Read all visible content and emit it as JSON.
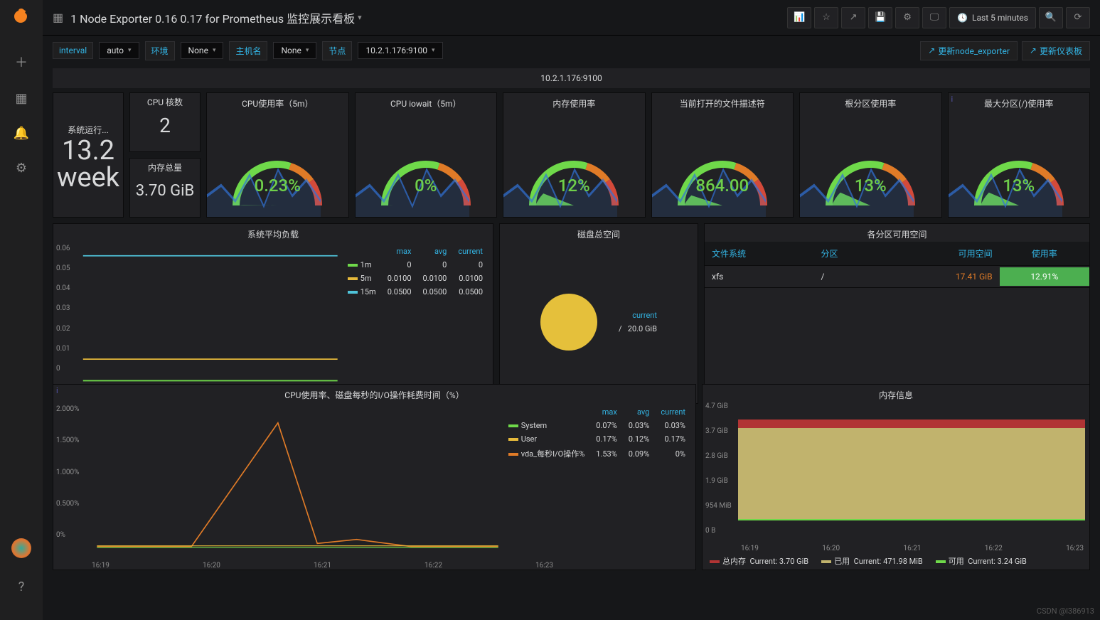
{
  "dashboard_title": "1 Node Exporter 0.16 0.17 for Prometheus 监控展示看板",
  "time_range": "Last 5 minutes",
  "variables": {
    "interval_label": "interval",
    "interval_value": "auto",
    "env_label": "环境",
    "env_value": "None",
    "host_label": "主机名",
    "host_value": "None",
    "node_label": "节点",
    "node_value": "10.2.1.176:9100"
  },
  "links": {
    "update_exporter": "更新node_exporter",
    "update_dashboard": "更新仪表板"
  },
  "row_header": "10.2.1.176:9100",
  "stats": {
    "uptime_title": "系统运行...",
    "uptime_value": "13.2 week",
    "cores_title": "CPU 核数",
    "cores_value": "2",
    "mem_title": "内存总量",
    "mem_value": "3.70 GiB"
  },
  "gauges": [
    {
      "title": "CPU使用率（5m）",
      "value": "0.23%",
      "pct": 0.23
    },
    {
      "title": "CPU iowait（5m）",
      "value": "0%",
      "pct": 0
    },
    {
      "title": "内存使用率",
      "value": "12%",
      "pct": 12
    },
    {
      "title": "当前打开的文件描述符",
      "value": "864.00",
      "pct": 10
    },
    {
      "title": "根分区使用率",
      "value": "13%",
      "pct": 13
    },
    {
      "title": "最大分区(/)使用率",
      "value": "13%",
      "pct": 13
    }
  ],
  "load_panel": {
    "title": "系统平均负载",
    "yticks": [
      "0.06",
      "0.05",
      "0.04",
      "0.03",
      "0.02",
      "0.01",
      "0"
    ],
    "xticks": [
      "16:19",
      "16:20",
      "16:21",
      "16:22",
      "16:23"
    ],
    "cols": [
      "max",
      "avg",
      "current"
    ],
    "series": [
      {
        "name": "1m",
        "color": "#6fd94a",
        "vals": [
          "0",
          "0",
          "0"
        ]
      },
      {
        "name": "5m",
        "color": "#e5b93b",
        "vals": [
          "0.0100",
          "0.0100",
          "0.0100"
        ]
      },
      {
        "name": "15m",
        "color": "#4fc3d9",
        "vals": [
          "0.0500",
          "0.0500",
          "0.0500"
        ]
      }
    ]
  },
  "disk_panel": {
    "title": "磁盘总空间",
    "legend_header": "current",
    "item": "/",
    "value": "20.0 GiB"
  },
  "partition_panel": {
    "title": "各分区可用空间",
    "headers": [
      "文件系统",
      "分区",
      "可用空间",
      "使用率"
    ],
    "row": {
      "fs": "xfs",
      "part": "/",
      "avail": "17.41 GiB",
      "use": "12.91%"
    }
  },
  "cpuio_panel": {
    "title": "CPU使用率、磁盘每秒的I/O操作耗费时间（%）",
    "yticks": [
      "2.000%",
      "1.500%",
      "1.000%",
      "0.500%",
      "0%"
    ],
    "xticks": [
      "16:19",
      "16:20",
      "16:21",
      "16:22",
      "16:23"
    ],
    "cols": [
      "max",
      "avg",
      "current"
    ],
    "series": [
      {
        "name": "System",
        "color": "#6fd94a",
        "vals": [
          "0.07%",
          "0.03%",
          "0.03%"
        ]
      },
      {
        "name": "User",
        "color": "#e5b93b",
        "vals": [
          "0.17%",
          "0.12%",
          "0.17%"
        ]
      },
      {
        "name": "vda_每秒I/O操作%",
        "color": "#e07b27",
        "vals": [
          "1.53%",
          "0.09%",
          "0%"
        ]
      }
    ]
  },
  "mem_panel": {
    "title": "内存信息",
    "yticks": [
      "4.7 GiB",
      "3.7 GiB",
      "2.8 GiB",
      "1.9 GiB",
      "954 MiB",
      "0 B"
    ],
    "xticks": [
      "16:19",
      "16:20",
      "16:21",
      "16:22",
      "16:23"
    ],
    "legend": [
      {
        "name": "总内存",
        "color": "#b13434",
        "current": "Current: 3.70 GiB"
      },
      {
        "name": "已用",
        "color": "#c1b36d",
        "current": "Current: 471.98 MiB"
      },
      {
        "name": "可用",
        "color": "#6fd94a",
        "current": "Current: 3.24 GiB"
      }
    ]
  },
  "watermark": "CSDN @l386913",
  "chart_data": {
    "type": "dashboard",
    "gauges": [
      {
        "label": "CPU使用率（5m）",
        "value": 0.23
      },
      {
        "label": "CPU iowait（5m）",
        "value": 0
      },
      {
        "label": "内存使用率",
        "value": 12
      },
      {
        "label": "打开文件描述符",
        "value": 864
      },
      {
        "label": "根分区使用率",
        "value": 13
      },
      {
        "label": "最大分区使用率",
        "value": 13
      }
    ],
    "load": {
      "x": [
        "16:19",
        "16:20",
        "16:21",
        "16:22",
        "16:23"
      ],
      "series": [
        {
          "name": "1m",
          "flat": 0
        },
        {
          "name": "5m",
          "flat": 0.01
        },
        {
          "name": "15m",
          "flat": 0.05
        }
      ],
      "ylim": [
        0,
        0.06
      ]
    },
    "disk_total": {
      "/": 20.0,
      "unit": "GiB"
    },
    "partitions": [
      {
        "fs": "xfs",
        "mount": "/",
        "avail_gib": 17.41,
        "use_pct": 12.91
      }
    ],
    "cpu_io": {
      "x": [
        "16:19",
        "16:20",
        "16:21",
        "16:22",
        "16:23"
      ],
      "ylim": [
        0,
        2.0
      ],
      "series": [
        {
          "name": "System",
          "values": [
            0.03,
            0.03,
            0.07,
            0.03,
            0.03
          ]
        },
        {
          "name": "User",
          "values": [
            0.12,
            0.12,
            0.17,
            0.14,
            0.17
          ]
        },
        {
          "name": "vda_io",
          "values": [
            0,
            0,
            1.53,
            0.1,
            0
          ]
        }
      ]
    },
    "memory": {
      "total_gib": 3.7,
      "used_mib": 471.98,
      "avail_gib": 3.24
    }
  }
}
